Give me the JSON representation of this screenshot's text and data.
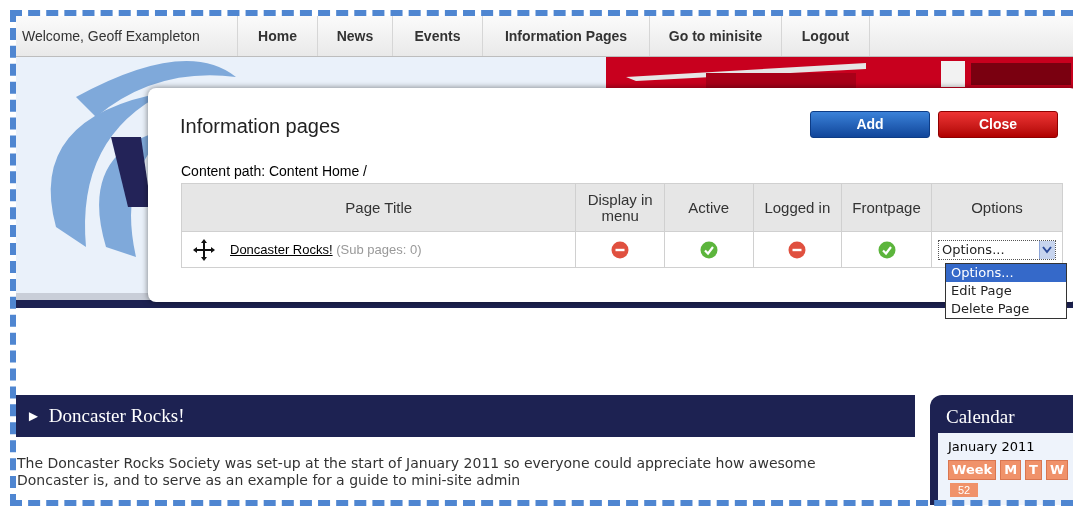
{
  "nav": {
    "welcome": "Welcome, Geoff Exampleton",
    "items": [
      {
        "label": "Home"
      },
      {
        "label": "News"
      },
      {
        "label": "Events"
      },
      {
        "label": "Information Pages"
      },
      {
        "label": "Go to minisite"
      },
      {
        "label": "Logout"
      }
    ]
  },
  "modal": {
    "title": "Information pages",
    "buttons": [
      {
        "label": "Add",
        "kind": "add"
      },
      {
        "label": "Close",
        "kind": "close"
      }
    ],
    "content_path": "Content Home /",
    "content_path_label": "Content path:",
    "columns": [
      "Page Title",
      "Display in menu",
      "Active",
      "Logged in",
      "Frontpage",
      "Options"
    ],
    "rows": [
      {
        "title": "Doncaster Rocks!",
        "sub_pages": "(Sub pages: 0)",
        "display_in_menu": false,
        "active": true,
        "logged_in": false,
        "frontpage": true,
        "options": {
          "value": "Options...",
          "expanded": true,
          "items": [
            {
              "label": "Options...",
              "selected": true
            },
            {
              "label": "Edit Page",
              "selected": false
            },
            {
              "label": "Delete Page",
              "selected": false
            }
          ]
        }
      }
    ]
  },
  "article": {
    "heading_marker": "►",
    "heading": "Doncaster Rocks!",
    "body": "The Doncaster Rocks Society was set-up at the start of January 2011 so everyone could appreciate how awesome Doncaster is, and to serve as an example for a guide to mini-site admin"
  },
  "calendar": {
    "title": "Calendar",
    "month": "January 2011",
    "day_buttons": [
      "Week",
      "M",
      "T",
      "W"
    ],
    "week_numbers": [
      "52"
    ]
  }
}
